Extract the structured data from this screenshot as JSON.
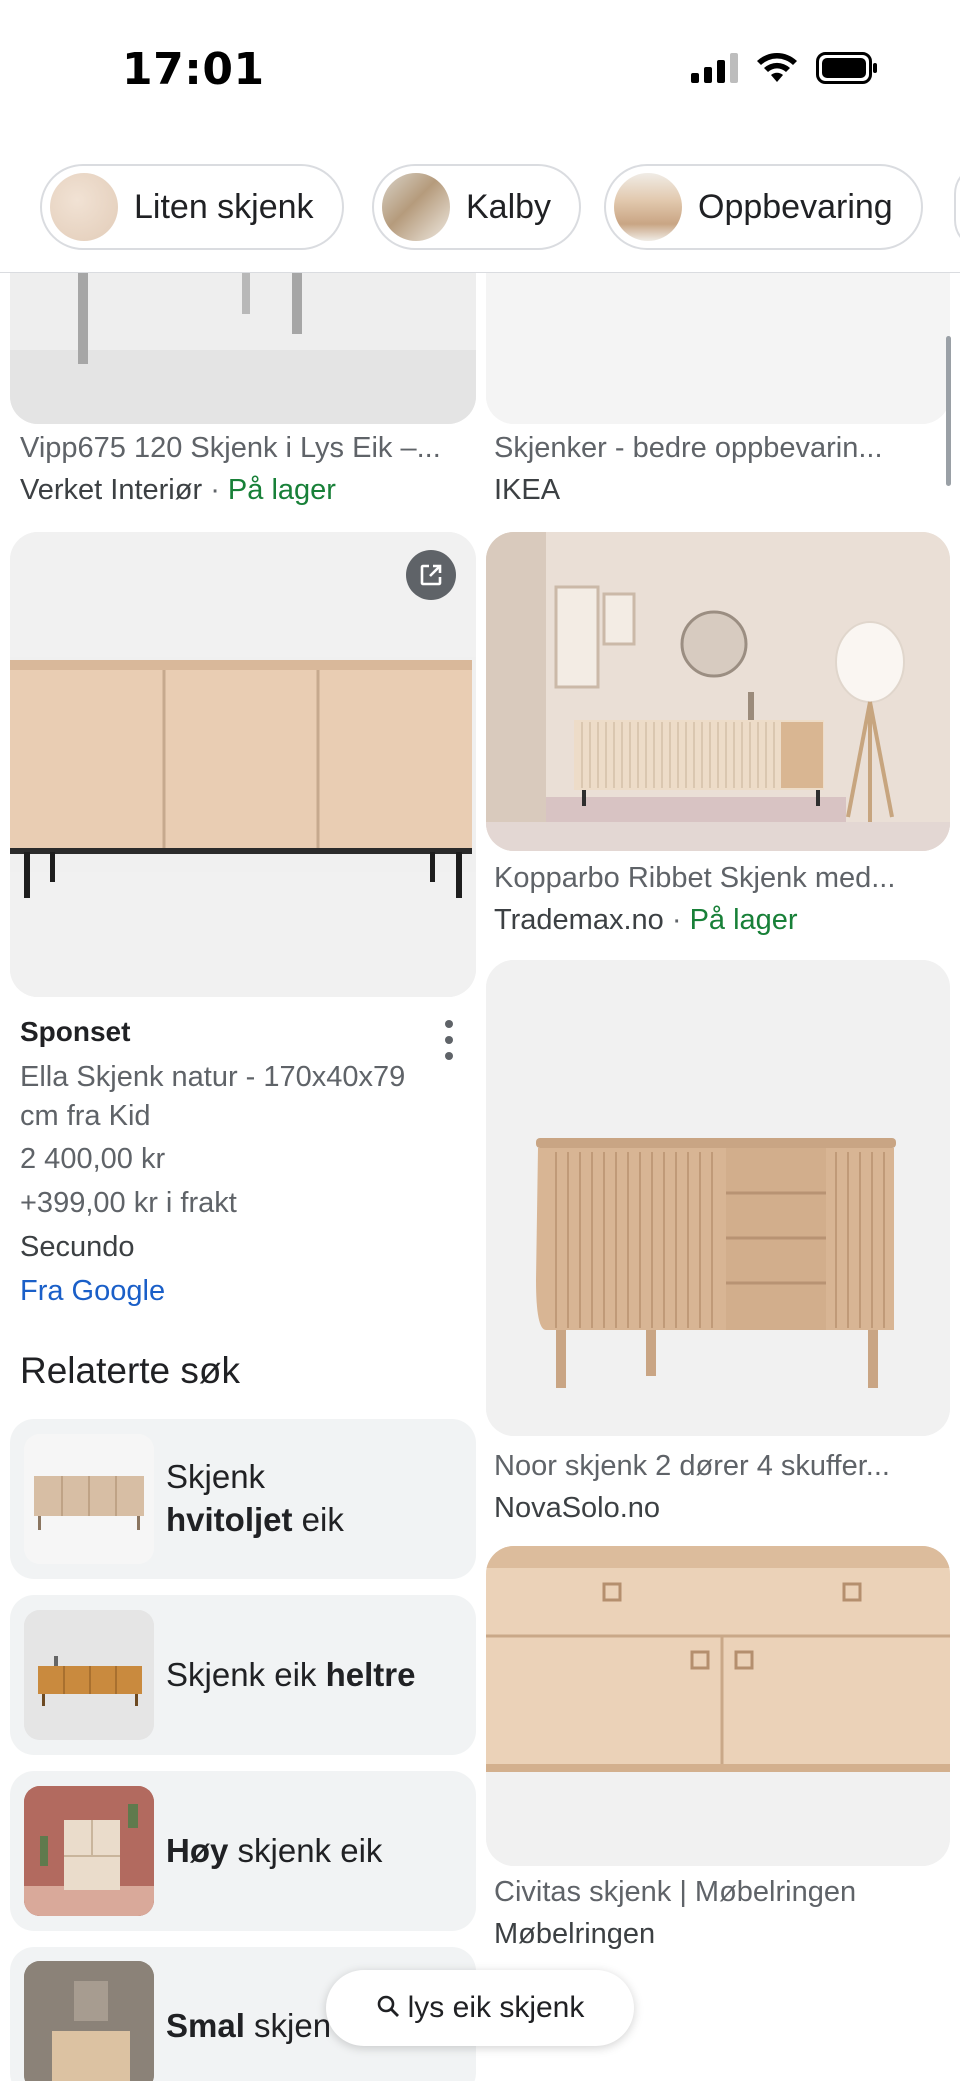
{
  "status_bar": {
    "time": "17:01"
  },
  "chips": [
    {
      "label": "Liten skjenk"
    },
    {
      "label": "Kalby"
    },
    {
      "label": "Oppbevaring"
    }
  ],
  "results_left": [
    {
      "title": "Vipp675 120 Skjenk i Lys Eik –...",
      "source": "Verket Interiør",
      "separator": "·",
      "availability": "På lager"
    }
  ],
  "results_right": [
    {
      "title": "Skjenker - bedre oppbevarin...",
      "source": "IKEA"
    },
    {
      "title": "Kopparbo Ribbet Skjenk med...",
      "source": "Trademax.no",
      "separator": "·",
      "availability": "På lager"
    },
    {
      "title": "Noor skjenk 2 dører 4 skuffer...",
      "source": "NovaSolo.no"
    },
    {
      "title": "Civitas skjenk | Møbelringen",
      "source": "Møbelringen"
    }
  ],
  "sponsored": {
    "label": "Sponset",
    "title_line1": "Ella Skjenk natur - 170x40x79",
    "title_line2": "cm fra Kid",
    "price": "2 400,00 kr",
    "shipping": "+399,00 kr i frakt",
    "seller": "Secundo",
    "link": "Fra Google"
  },
  "related": {
    "heading": "Relaterte søk",
    "items": [
      {
        "pre": "Skjenk",
        "bold": "hvitoljet",
        "post": " eik"
      },
      {
        "pre": "Skjenk eik ",
        "bold": "heltre",
        "post": ""
      },
      {
        "pre": "",
        "bold": "Høy",
        "post": " skjenk eik"
      },
      {
        "pre": "",
        "bold": "Smal",
        "post": " skjen"
      }
    ]
  },
  "search_pill": {
    "query": "lys eik skjenk"
  },
  "colors": {
    "link_blue": "#1a5fc8",
    "stock_green": "#188038",
    "chip_border": "#dadce0",
    "related_bg": "#f1f3f4"
  },
  "icons": [
    "signal-icon",
    "wifi-icon",
    "battery-icon",
    "external-link-icon",
    "more-vert-icon",
    "search-icon"
  ]
}
